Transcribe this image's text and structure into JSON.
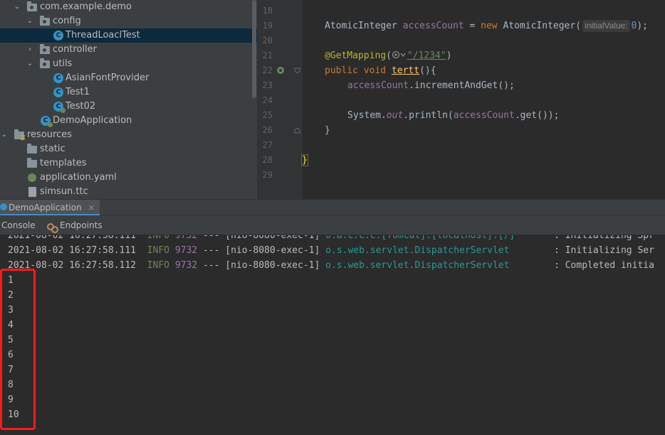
{
  "project_tree": {
    "items": [
      {
        "label": "com.example.demo",
        "kind": "package",
        "expanded": true
      },
      {
        "label": "config",
        "kind": "package",
        "expanded": true
      },
      {
        "label": "ThreadLoaclTest",
        "kind": "class",
        "selected": true
      },
      {
        "label": "controller",
        "kind": "package",
        "expanded": false
      },
      {
        "label": "utils",
        "kind": "package",
        "expanded": true
      },
      {
        "label": "AsianFontProvider",
        "kind": "class"
      },
      {
        "label": "Test1",
        "kind": "class"
      },
      {
        "label": "Test02",
        "kind": "spring-class"
      },
      {
        "label": "DemoApplication",
        "kind": "spring-class"
      },
      {
        "label": "resources",
        "kind": "resources-folder",
        "expanded": true
      },
      {
        "label": "static",
        "kind": "folder"
      },
      {
        "label": "templates",
        "kind": "folder"
      },
      {
        "label": "application.yaml",
        "kind": "yaml-file"
      },
      {
        "label": "simsun.ttc",
        "kind": "file"
      }
    ],
    "class_icon_letter": "C"
  },
  "editor": {
    "line_numbers": [
      "18",
      "19",
      "20",
      "21",
      "22",
      "23",
      "24",
      "25",
      "26",
      "27",
      "28",
      "29"
    ],
    "hint_initial_value": "initialValue:",
    "code": {
      "type_atomic": "AtomicInteger",
      "field_access": "accessCount",
      "eq_new": " = ",
      "kw_new": "new",
      "type_atomic2": " AtomicInteger(",
      "init_val": "0",
      "close_semicolon": ");",
      "annotation": "@GetMapping",
      "ann_open": "(",
      "ann_string": "\"/1234\"",
      "ann_close": ")",
      "kw_public": "public",
      "kw_void": " void ",
      "method_name": "tertt",
      "method_open": "(){",
      "incr_field": "accessCount",
      "incr_call": ".incrementAndGet();",
      "sys": "System.",
      "sys_out": "out",
      "println_open": ".println(",
      "println_field": "accessCount",
      "println_close": ".get());",
      "brace_close_method": "}",
      "brace_close_class": "}"
    }
  },
  "run_window": {
    "tab_label": "DemoApplication",
    "tab_close": "×",
    "subtabs": {
      "console": "Console",
      "endpoints": "Endpoints"
    },
    "log_lines": [
      {
        "time": "2021-08-02 16:27:58.111",
        "level": "INFO",
        "pid": "9732",
        "sep": "---",
        "thread": "[nio-8080-exec-1]",
        "logger": "o.a.c.c.C.[Tomcat].[localhost].[/]",
        "msg": ": Initializing Spr"
      },
      {
        "time": "2021-08-02 16:27:58.111",
        "level": "INFO",
        "pid": "9732",
        "sep": "---",
        "thread": "[nio-8080-exec-1]",
        "logger": "o.s.web.servlet.DispatcherServlet",
        "msg": ": Initializing Ser"
      },
      {
        "time": "2021-08-02 16:27:58.112",
        "level": "INFO",
        "pid": "9732",
        "sep": "---",
        "thread": "[nio-8080-exec-1]",
        "logger": "o.s.web.servlet.DispatcherServlet",
        "msg": ": Completed initia"
      }
    ],
    "output_lines": [
      "1",
      "2",
      "3",
      "4",
      "5",
      "6",
      "7",
      "8",
      "9",
      "10"
    ]
  },
  "colors": {
    "highlight_box": "#ff1a1a",
    "selection": "#0d293e",
    "keyword": "#cc7832",
    "field": "#9876aa",
    "method": "#ffc66d",
    "annotation": "#bbb529",
    "string": "#6a8759",
    "number": "#6897bb"
  }
}
